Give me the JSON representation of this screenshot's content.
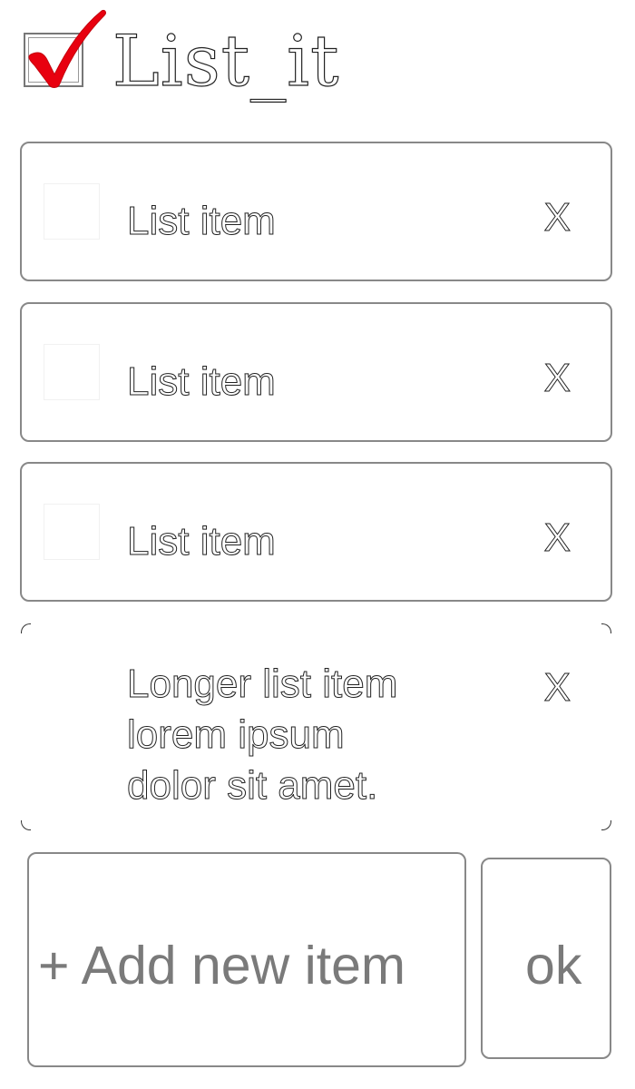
{
  "app": {
    "title": "List_it",
    "logo_icon": "checkmark-checkbox-icon",
    "accent_color": "#e8000f"
  },
  "list": {
    "items": [
      {
        "label": "List item",
        "delete_label": "X"
      },
      {
        "label": "List item",
        "delete_label": "X"
      },
      {
        "label": "List item",
        "delete_label": "X"
      },
      {
        "label": "Longer list item\nlorem ipsum\ndolor sit amet.",
        "delete_label": "X"
      }
    ]
  },
  "composer": {
    "add_label": "+ Add new item",
    "ok_label": "ok"
  }
}
